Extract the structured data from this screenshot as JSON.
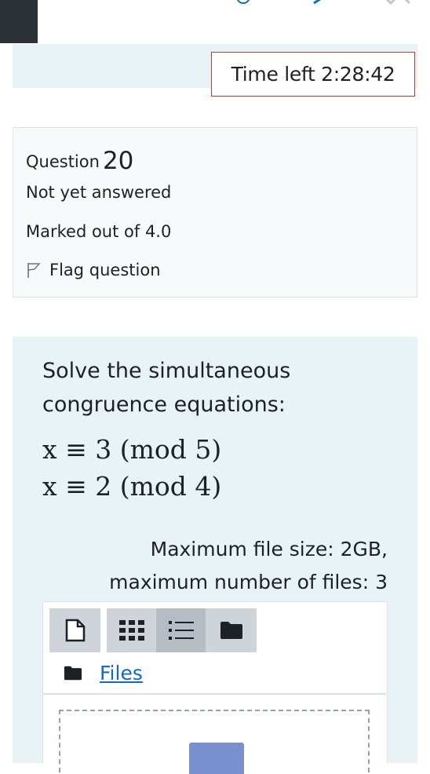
{
  "timer": {
    "label": "Time left",
    "value": "2:28:42",
    "text": "Time left 2:28:42",
    "border_color": "#c0392b"
  },
  "question_info": {
    "label": "Question",
    "number": "20",
    "state": "Not yet answered",
    "grade": "Marked out of 4.0",
    "flag_label": "Flag question"
  },
  "question": {
    "prompt": "Solve the simultaneous congruence equations:",
    "equations": [
      "x ≡ 3 (mod 5)",
      "x ≡ 2 (mod 4)"
    ],
    "max_file_size": "Maximum file size: 2GB,",
    "max_files": "maximum number of files: 3"
  },
  "file_manager": {
    "buttons": [
      {
        "name": "add-file",
        "icon": "file-icon"
      },
      {
        "name": "view-icons",
        "icon": "grid-icon"
      },
      {
        "name": "view-list",
        "icon": "list-icon",
        "active": true
      },
      {
        "name": "view-tree",
        "icon": "folder-icon"
      }
    ],
    "path_label": "Files"
  },
  "colors": {
    "link": "#0f6cbf",
    "panel_bg": "#e7f3f5",
    "info_bg": "#f8f9fa",
    "nav_dark": "#2a3036"
  }
}
